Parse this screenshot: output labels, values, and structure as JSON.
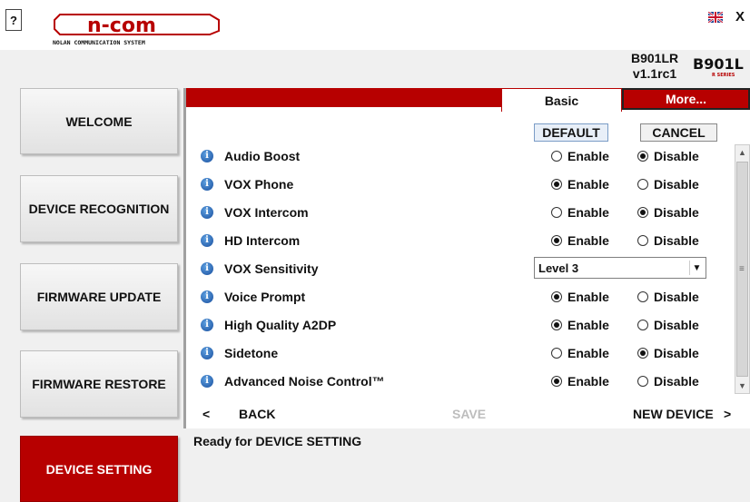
{
  "topbar": {
    "help_label": "?",
    "logo_text": "n-com",
    "logo_tagline": "NOLAN COMMUNICATION SYSTEM",
    "close_label": "X"
  },
  "device": {
    "model": "B901LR",
    "version": "v1.1rc1",
    "brand_text": "B901L",
    "brand_subtext": "R SERIES"
  },
  "sidebar": {
    "items": [
      {
        "label": "WELCOME"
      },
      {
        "label": "DEVICE RECOGNITION"
      },
      {
        "label": "FIRMWARE UPDATE"
      },
      {
        "label": "FIRMWARE RESTORE"
      },
      {
        "label": "DEVICE SETTING",
        "active": true
      }
    ]
  },
  "tabs": {
    "basic": "Basic",
    "more": "More..."
  },
  "buttons": {
    "default": "DEFAULT",
    "cancel": "CANCEL"
  },
  "options": {
    "enable": "Enable",
    "disable": "Disable"
  },
  "settings": [
    {
      "label": "Audio Boost",
      "value": "Disable"
    },
    {
      "label": "VOX Phone",
      "value": "Enable"
    },
    {
      "label": "VOX Intercom",
      "value": "Disable"
    },
    {
      "label": "HD Intercom",
      "value": "Enable"
    },
    {
      "label": "VOX Sensitivity",
      "value": "Level 3"
    },
    {
      "label": "Voice Prompt",
      "value": "Enable"
    },
    {
      "label": "High Quality A2DP",
      "value": "Enable"
    },
    {
      "label": "Sidetone",
      "value": "Disable"
    },
    {
      "label": "Advanced Noise Control™",
      "value": "Enable"
    }
  ],
  "nav": {
    "back_arrow": "<",
    "back": "BACK",
    "save": "SAVE",
    "new_device": "NEW DEVICE",
    "next_arrow": ">"
  },
  "status": "Ready for DEVICE SETTING",
  "colors": {
    "accent_red": "#b70000",
    "info_blue": "#1a4f9e"
  }
}
